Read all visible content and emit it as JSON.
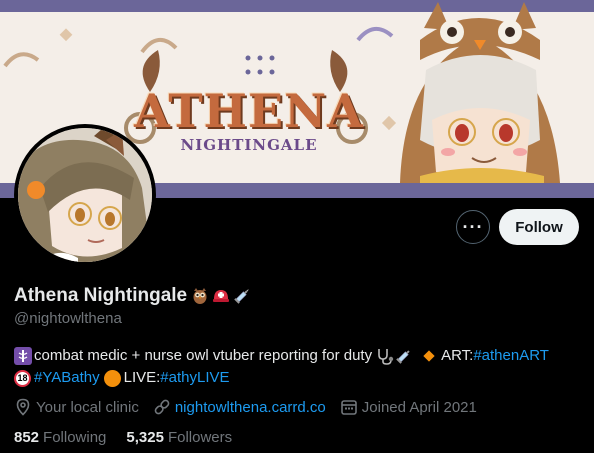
{
  "banner": {
    "logo_title": "ATHENA",
    "logo_subtitle": "NIGHTINGALE"
  },
  "actions": {
    "follow_label": "Follow"
  },
  "profile": {
    "display_name": "Athena Nightingale",
    "handle": "@nightowlthena",
    "name_emoji_icons": [
      "owl-icon",
      "rescue-helmet-icon",
      "syringe-icon"
    ]
  },
  "bio": {
    "line1_text": "combat medic + nurse owl vtuber reporting for duty",
    "art_label": "ART: ",
    "art_hashtag": "#athenART",
    "bath_hashtag": "#YABathy",
    "live_label": "LIVE: ",
    "live_hashtag": "#athyLIVE",
    "adult_badge": "18"
  },
  "meta": {
    "location": "Your local clinic",
    "website": "nightowlthena.carrd.co",
    "joined": "Joined April 2021"
  },
  "stats": {
    "following_count": "852",
    "following_label": "Following",
    "followers_count": "5,325",
    "followers_label": "Followers"
  },
  "colors": {
    "background": "#000000",
    "link": "#1d9bf0",
    "secondary_text": "#71767b",
    "banner_band": "#6b6699",
    "banner_bg": "#f4eee8"
  }
}
